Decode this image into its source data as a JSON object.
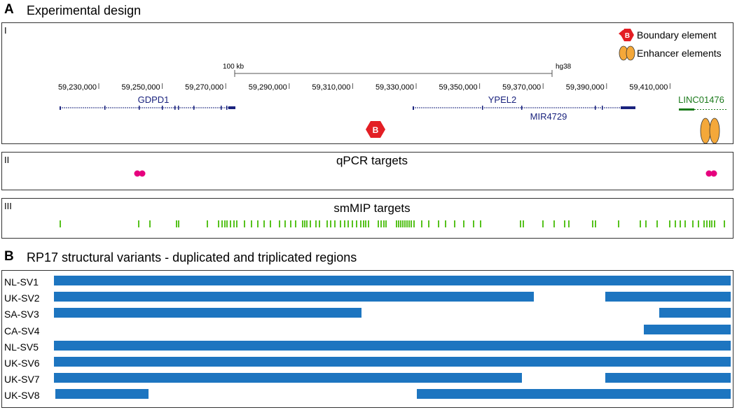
{
  "colors": {
    "gene": "#1a237e",
    "linc": "#1b7a1b",
    "boundary": "#e31e24",
    "enhancer": "#f4a83a",
    "qpcr": "#e6007e",
    "smmip": "#57c21e",
    "variant_bar": "#1d75c0"
  },
  "icons": {
    "boundary": "hexagon-icon",
    "enhancer": "double-ellipse-icon",
    "qpcr": "double-dot-icon"
  },
  "section_a": {
    "letter": "A",
    "title": "Experimental design",
    "panel_i": {
      "roman": "I",
      "legend": {
        "boundary_label": "Boundary element",
        "boundary_glyph": "B",
        "enhancer_label": "Enhancer elements"
      },
      "scale": {
        "label": "100 kb",
        "assembly": "hg38"
      },
      "ticks": [
        "59,230,000",
        "59,250,000",
        "59,270,000",
        "59,290,000",
        "59,310,000",
        "59,330,000",
        "59,350,000",
        "59,370,000",
        "59,390,000",
        "59,410,000"
      ],
      "genes": {
        "gdpd1": "GDPD1",
        "ypel2": "YPEL2",
        "mir4729": "MIR4729",
        "linc": "LINC01476"
      }
    },
    "panel_ii": {
      "roman": "II",
      "title": "qPCR targets",
      "targets": [
        "left",
        "right"
      ]
    },
    "panel_iii": {
      "roman": "III",
      "title": "smMIP targets"
    }
  },
  "section_b": {
    "letter": "B",
    "title": "RP17 structural variants - duplicated and triplicated regions",
    "variants": [
      {
        "label": "NL-SV1",
        "segments": [
          [
            0.0,
            1.0
          ]
        ]
      },
      {
        "label": "UK-SV2",
        "segments": [
          [
            0.0,
            0.709
          ],
          [
            0.815,
            1.0
          ]
        ]
      },
      {
        "label": "SA-SV3",
        "segments": [
          [
            0.0,
            0.454
          ],
          [
            0.894,
            1.0
          ]
        ]
      },
      {
        "label": "CA-SV4",
        "segments": [
          [
            0.872,
            1.0
          ]
        ]
      },
      {
        "label": "NL-SV5",
        "segments": [
          [
            0.0,
            1.0
          ]
        ]
      },
      {
        "label": "UK-SV6",
        "segments": [
          [
            0.0,
            1.0
          ]
        ]
      },
      {
        "label": "UK-SV7",
        "segments": [
          [
            0.0,
            0.692
          ],
          [
            0.815,
            1.0
          ]
        ]
      },
      {
        "label": "UK-SV8",
        "segments": [
          [
            0.002,
            0.14
          ],
          [
            0.536,
            1.0
          ]
        ]
      }
    ]
  }
}
